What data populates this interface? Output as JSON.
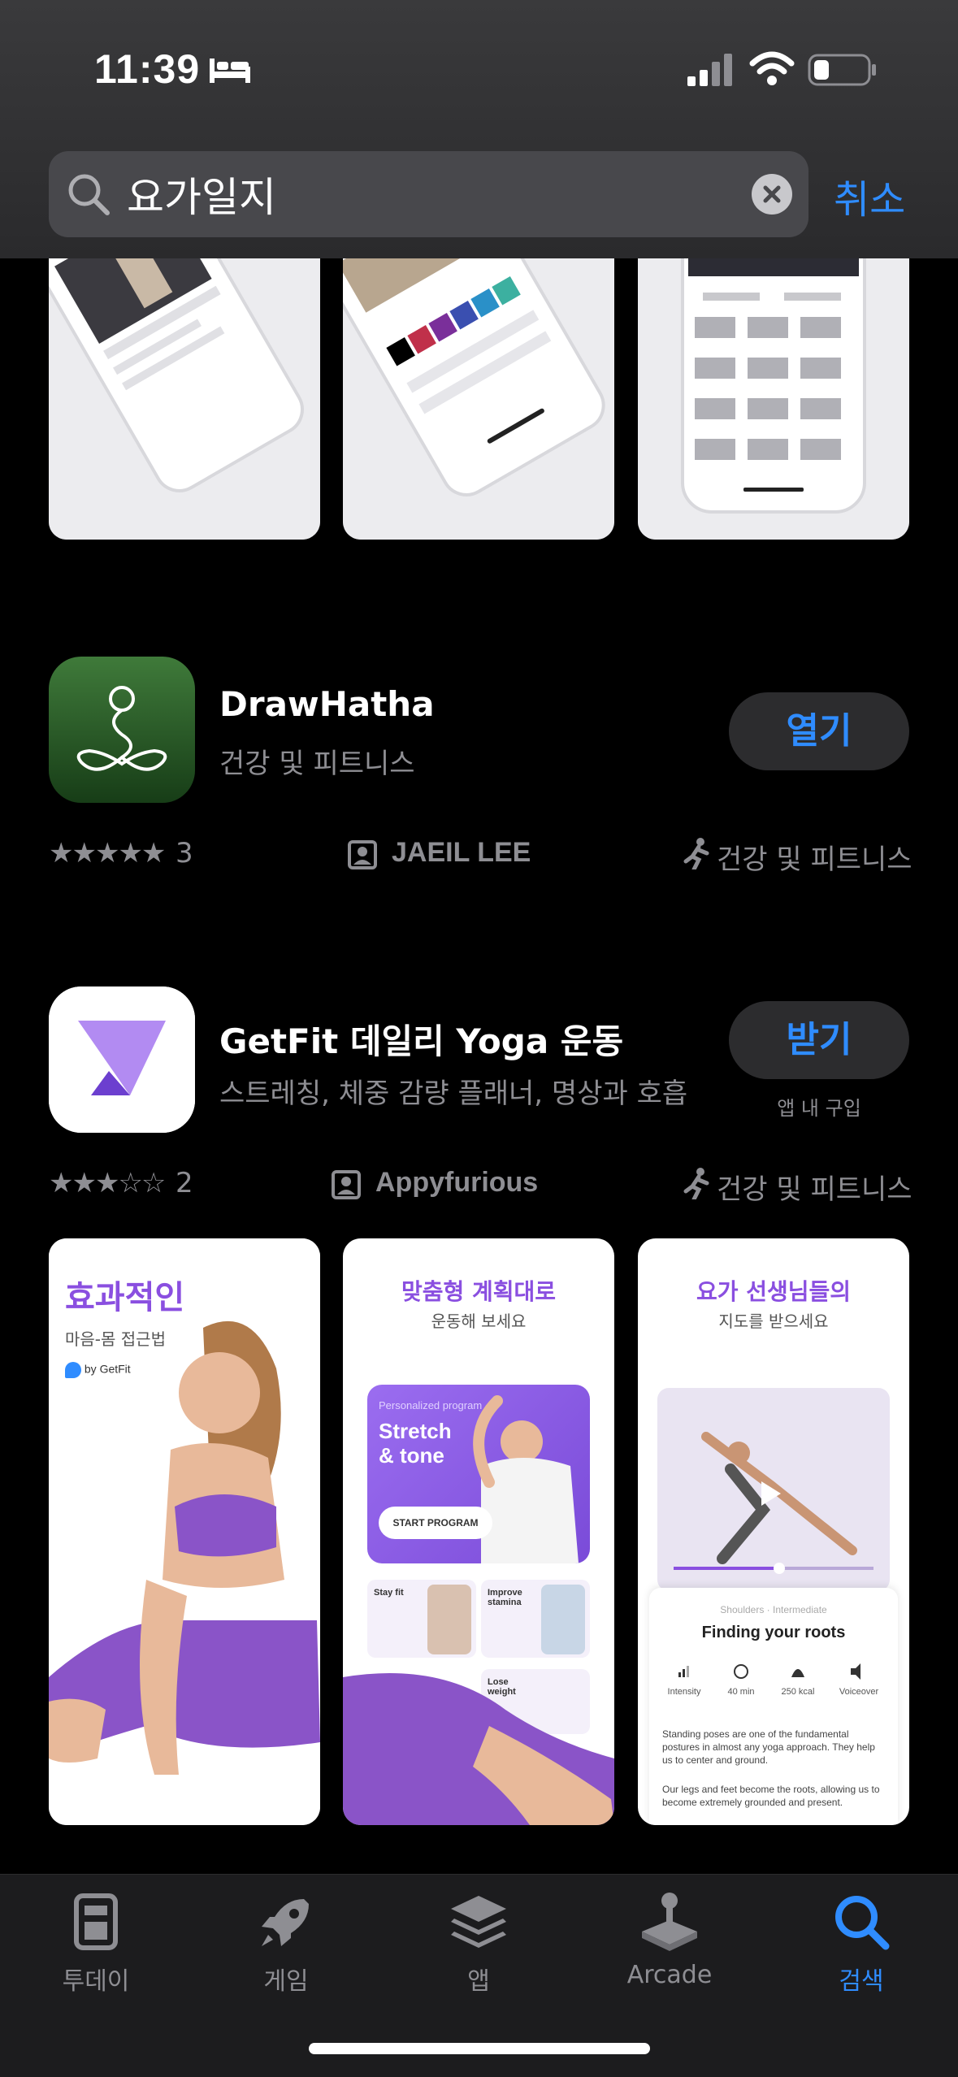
{
  "status_bar": {
    "time": "11:39"
  },
  "search": {
    "query": "요가일지",
    "cancel_label": "취소"
  },
  "results": [
    {
      "name": "DrawHatha",
      "subtitle": "건강 및 피트니스",
      "action_label": "열기",
      "rating_stars": "★★★★★",
      "rating_count": "3",
      "developer": "JAEIL LEE",
      "category": "건강 및 피트니스",
      "icon": "yoga-pose-icon"
    },
    {
      "name": "GetFit 데일리 Yoga 운동",
      "subtitle": "스트레칭, 체중 감량 플래너, 명상과 호흡",
      "action_label": "받기",
      "in_app_purchase": "앱 내 구입",
      "rating_stars": "★★★☆☆",
      "rating_count": "2",
      "developer": "Appyfurious",
      "category": "건강 및 피트니스",
      "icon": "getfit-logo-icon",
      "screenshots": [
        {
          "title": "효과적인",
          "subtitle": "마음-몸 접근법",
          "brand": "by GetFit"
        },
        {
          "title": "맞춤형 계획대로",
          "subtitle": "운동해 보세요",
          "program_label": "Personalized program",
          "program_title_1": "Stretch",
          "program_title_2": "& tone",
          "program_button": "START PROGRAM",
          "tile_1": "Stay fit",
          "tile_2": "Improve stamina",
          "tile_3": "Lose weight"
        },
        {
          "title": "요가 선생님들의",
          "subtitle": "지도를 받으세요",
          "crumb": "Shoulders · Intermediate",
          "card_title": "Finding your roots",
          "stat_1": "Intensity",
          "stat_2": "40 min",
          "stat_3": "250 kcal",
          "stat_4": "Voiceover",
          "body_1": "Standing poses are one of the fundamental postures in almost any yoga approach. They help us to center and ground.",
          "body_2": "Our legs and feet become the roots, allowing us to become extremely grounded and present."
        }
      ]
    }
  ],
  "tabs": [
    {
      "label": "투데이",
      "icon": "today-icon"
    },
    {
      "label": "게임",
      "icon": "rocket-icon"
    },
    {
      "label": "앱",
      "icon": "layers-icon"
    },
    {
      "label": "Arcade",
      "icon": "joystick-icon"
    },
    {
      "label": "검색",
      "icon": "search-icon"
    }
  ],
  "colors": {
    "accent": "#2f8cff",
    "background": "#000000",
    "secondary_text": "#8e8e93",
    "purple": "#8a4fe0"
  }
}
